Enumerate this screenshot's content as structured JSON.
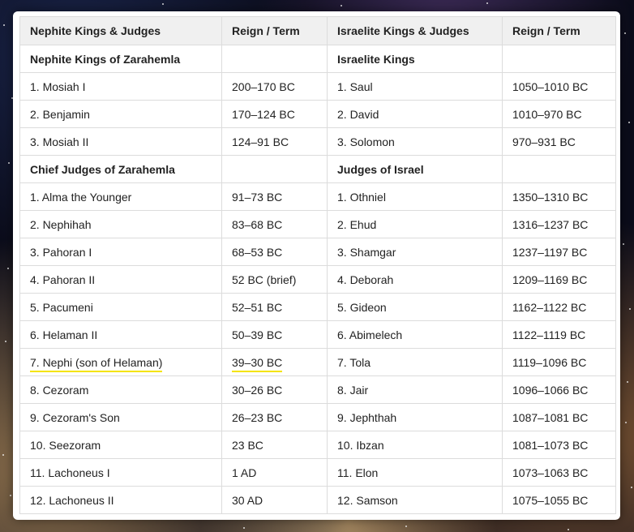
{
  "headers": [
    "Nephite Kings & Judges",
    "Reign / Term",
    "Israelite Kings & Judges",
    "Reign / Term"
  ],
  "rows": [
    {
      "group": true,
      "cells": [
        "Nephite Kings of Zarahemla",
        "",
        "Israelite Kings",
        ""
      ]
    },
    {
      "group": false,
      "cells": [
        "1. Mosiah I",
        "200–170 BC",
        "1. Saul",
        "1050–1010 BC"
      ]
    },
    {
      "group": false,
      "cells": [
        "2. Benjamin",
        "170–124 BC",
        "2. David",
        "1010–970 BC"
      ]
    },
    {
      "group": false,
      "cells": [
        "3. Mosiah II",
        "124–91 BC",
        "3. Solomon",
        "970–931 BC"
      ]
    },
    {
      "group": true,
      "cells": [
        "Chief Judges of Zarahemla",
        "",
        "Judges of Israel",
        ""
      ]
    },
    {
      "group": false,
      "cells": [
        "1. Alma the Younger",
        "91–73 BC",
        "1. Othniel",
        "1350–1310 BC"
      ]
    },
    {
      "group": false,
      "cells": [
        "2. Nephihah",
        "83–68 BC",
        "2. Ehud",
        "1316–1237 BC"
      ]
    },
    {
      "group": false,
      "cells": [
        "3. Pahoran I",
        "68–53 BC",
        "3. Shamgar",
        "1237–1197 BC"
      ]
    },
    {
      "group": false,
      "cells": [
        "4. Pahoran II",
        "52 BC (brief)",
        "4. Deborah",
        "1209–1169 BC"
      ]
    },
    {
      "group": false,
      "cells": [
        "5. Pacumeni",
        "52–51 BC",
        "5. Gideon",
        "1162–1122 BC"
      ]
    },
    {
      "group": false,
      "cells": [
        "6. Helaman II",
        "50–39 BC",
        "6. Abimelech",
        "1122–1119 BC"
      ]
    },
    {
      "group": false,
      "highlight": true,
      "cells": [
        "7. Nephi (son of Helaman)",
        "39–30 BC",
        "7. Tola",
        "1119–1096 BC"
      ]
    },
    {
      "group": false,
      "cells": [
        "8. Cezoram",
        "30–26 BC",
        "8. Jair",
        "1096–1066 BC"
      ]
    },
    {
      "group": false,
      "cells": [
        "9. Cezoram's Son",
        "26–23 BC",
        "9. Jephthah",
        "1087–1081 BC"
      ]
    },
    {
      "group": false,
      "cells": [
        "10. Seezoram",
        "23 BC",
        "10. Ibzan",
        "1081–1073 BC"
      ]
    },
    {
      "group": false,
      "cells": [
        "11. Lachoneus I",
        "1 AD",
        "11. Elon",
        "1073–1063 BC"
      ]
    },
    {
      "group": false,
      "cells": [
        "12. Lachoneus II",
        "30 AD",
        "12. Samson",
        "1075–1055 BC"
      ]
    }
  ],
  "colors": {
    "highlight": "#f4e400",
    "header_bg": "#f0f0f0",
    "border": "#dcdcdc"
  }
}
